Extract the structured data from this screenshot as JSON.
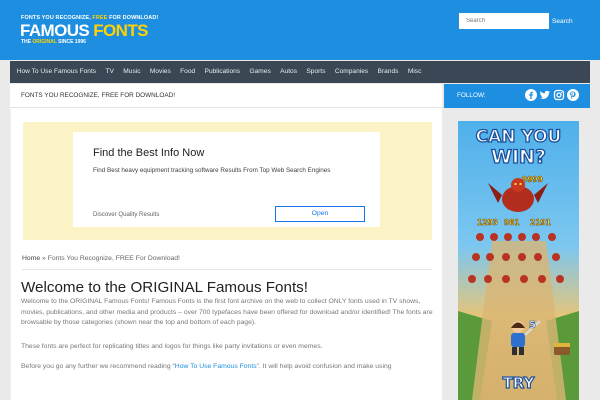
{
  "header": {
    "logo": {
      "tagline_prefix": "FONTS YOU RECOGNIZE, ",
      "tagline_free": "FREE",
      "tagline_suffix": " FOR DOWNLOAD!",
      "name_part1": "FAMOUS",
      "name_part2": " FONTS",
      "sub_prefix": "THE ",
      "sub_original": "ORIGINAL",
      "sub_suffix": " SINCE 1996"
    },
    "search": {
      "placeholder": "Search",
      "button_label": "Search"
    }
  },
  "nav": {
    "items": [
      "How To Use Famous Fonts",
      "TV",
      "Music",
      "Movies",
      "Food",
      "Publications",
      "Games",
      "Autos",
      "Sports",
      "Companies",
      "Brands",
      "Misc"
    ]
  },
  "content": {
    "heading": "FONTS YOU RECOGNIZE, FREE FOR DOWNLOAD!",
    "ad": {
      "title": "Find the Best Info Now",
      "description": "Find Best heavy equipment tracking software Results From Top Web Search Engines",
      "source": "Discover Quality Results",
      "button": "Open"
    },
    "breadcrumb": {
      "home": "Home",
      "separator": " » ",
      "current": "Fonts You Recognize, FREE For Download!"
    },
    "article": {
      "title": "Welcome to the ORIGINAL Famous Fonts!",
      "para1": "Welcome to the ORIGINAL Famous Fonts! Famous Fonts is the first font archive on the web to collect ONLY fonts used in TV shows, movies, publications, and other media and products – over 700 typefaces have been offered for download and/or identified! The fonts are browsable by those categories (shown near the top and bottom of each page).",
      "para2": "These fonts are perfect for replicating titles and logos for things like party invitations or even memes.",
      "para3_prefix": "Before you go any further we recommend reading “",
      "para3_link": "How To Use Famous Fonts",
      "para3_suffix": "”. It will help avoid confusion and make using"
    }
  },
  "sidebar": {
    "follow_label": "FOLLOW:",
    "social": [
      "facebook-icon",
      "twitter-icon",
      "instagram-icon",
      "pinterest-icon"
    ],
    "game_ad": {
      "headline_1": "CAN YOU",
      "headline_2": "WIN?",
      "numbers": [
        "9999",
        "1293",
        "981",
        "2191",
        "5"
      ],
      "cta": "TRY"
    }
  },
  "colors": {
    "brand_blue": "#1e8fe0",
    "logo_yellow": "#ffd200",
    "nav_dark": "#3b4754",
    "ad_background": "#fbf3c5",
    "ad_link_blue": "#1a73e8"
  }
}
